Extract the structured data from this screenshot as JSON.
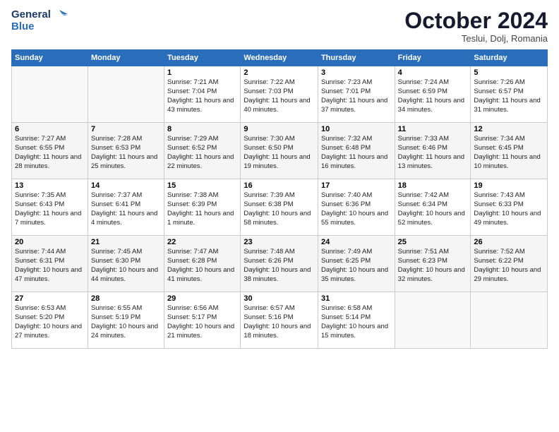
{
  "header": {
    "logo_line1": "General",
    "logo_line2": "Blue",
    "month_title": "October 2024",
    "subtitle": "Teslui, Dolj, Romania"
  },
  "weekdays": [
    "Sunday",
    "Monday",
    "Tuesday",
    "Wednesday",
    "Thursday",
    "Friday",
    "Saturday"
  ],
  "weeks": [
    [
      {
        "day": "",
        "data": ""
      },
      {
        "day": "",
        "data": ""
      },
      {
        "day": "1",
        "data": "Sunrise: 7:21 AM\nSunset: 7:04 PM\nDaylight: 11 hours and 43 minutes."
      },
      {
        "day": "2",
        "data": "Sunrise: 7:22 AM\nSunset: 7:03 PM\nDaylight: 11 hours and 40 minutes."
      },
      {
        "day": "3",
        "data": "Sunrise: 7:23 AM\nSunset: 7:01 PM\nDaylight: 11 hours and 37 minutes."
      },
      {
        "day": "4",
        "data": "Sunrise: 7:24 AM\nSunset: 6:59 PM\nDaylight: 11 hours and 34 minutes."
      },
      {
        "day": "5",
        "data": "Sunrise: 7:26 AM\nSunset: 6:57 PM\nDaylight: 11 hours and 31 minutes."
      }
    ],
    [
      {
        "day": "6",
        "data": "Sunrise: 7:27 AM\nSunset: 6:55 PM\nDaylight: 11 hours and 28 minutes."
      },
      {
        "day": "7",
        "data": "Sunrise: 7:28 AM\nSunset: 6:53 PM\nDaylight: 11 hours and 25 minutes."
      },
      {
        "day": "8",
        "data": "Sunrise: 7:29 AM\nSunset: 6:52 PM\nDaylight: 11 hours and 22 minutes."
      },
      {
        "day": "9",
        "data": "Sunrise: 7:30 AM\nSunset: 6:50 PM\nDaylight: 11 hours and 19 minutes."
      },
      {
        "day": "10",
        "data": "Sunrise: 7:32 AM\nSunset: 6:48 PM\nDaylight: 11 hours and 16 minutes."
      },
      {
        "day": "11",
        "data": "Sunrise: 7:33 AM\nSunset: 6:46 PM\nDaylight: 11 hours and 13 minutes."
      },
      {
        "day": "12",
        "data": "Sunrise: 7:34 AM\nSunset: 6:45 PM\nDaylight: 11 hours and 10 minutes."
      }
    ],
    [
      {
        "day": "13",
        "data": "Sunrise: 7:35 AM\nSunset: 6:43 PM\nDaylight: 11 hours and 7 minutes."
      },
      {
        "day": "14",
        "data": "Sunrise: 7:37 AM\nSunset: 6:41 PM\nDaylight: 11 hours and 4 minutes."
      },
      {
        "day": "15",
        "data": "Sunrise: 7:38 AM\nSunset: 6:39 PM\nDaylight: 11 hours and 1 minute."
      },
      {
        "day": "16",
        "data": "Sunrise: 7:39 AM\nSunset: 6:38 PM\nDaylight: 10 hours and 58 minutes."
      },
      {
        "day": "17",
        "data": "Sunrise: 7:40 AM\nSunset: 6:36 PM\nDaylight: 10 hours and 55 minutes."
      },
      {
        "day": "18",
        "data": "Sunrise: 7:42 AM\nSunset: 6:34 PM\nDaylight: 10 hours and 52 minutes."
      },
      {
        "day": "19",
        "data": "Sunrise: 7:43 AM\nSunset: 6:33 PM\nDaylight: 10 hours and 49 minutes."
      }
    ],
    [
      {
        "day": "20",
        "data": "Sunrise: 7:44 AM\nSunset: 6:31 PM\nDaylight: 10 hours and 47 minutes."
      },
      {
        "day": "21",
        "data": "Sunrise: 7:45 AM\nSunset: 6:30 PM\nDaylight: 10 hours and 44 minutes."
      },
      {
        "day": "22",
        "data": "Sunrise: 7:47 AM\nSunset: 6:28 PM\nDaylight: 10 hours and 41 minutes."
      },
      {
        "day": "23",
        "data": "Sunrise: 7:48 AM\nSunset: 6:26 PM\nDaylight: 10 hours and 38 minutes."
      },
      {
        "day": "24",
        "data": "Sunrise: 7:49 AM\nSunset: 6:25 PM\nDaylight: 10 hours and 35 minutes."
      },
      {
        "day": "25",
        "data": "Sunrise: 7:51 AM\nSunset: 6:23 PM\nDaylight: 10 hours and 32 minutes."
      },
      {
        "day": "26",
        "data": "Sunrise: 7:52 AM\nSunset: 6:22 PM\nDaylight: 10 hours and 29 minutes."
      }
    ],
    [
      {
        "day": "27",
        "data": "Sunrise: 6:53 AM\nSunset: 5:20 PM\nDaylight: 10 hours and 27 minutes."
      },
      {
        "day": "28",
        "data": "Sunrise: 6:55 AM\nSunset: 5:19 PM\nDaylight: 10 hours and 24 minutes."
      },
      {
        "day": "29",
        "data": "Sunrise: 6:56 AM\nSunset: 5:17 PM\nDaylight: 10 hours and 21 minutes."
      },
      {
        "day": "30",
        "data": "Sunrise: 6:57 AM\nSunset: 5:16 PM\nDaylight: 10 hours and 18 minutes."
      },
      {
        "day": "31",
        "data": "Sunrise: 6:58 AM\nSunset: 5:14 PM\nDaylight: 10 hours and 15 minutes."
      },
      {
        "day": "",
        "data": ""
      },
      {
        "day": "",
        "data": ""
      }
    ]
  ]
}
